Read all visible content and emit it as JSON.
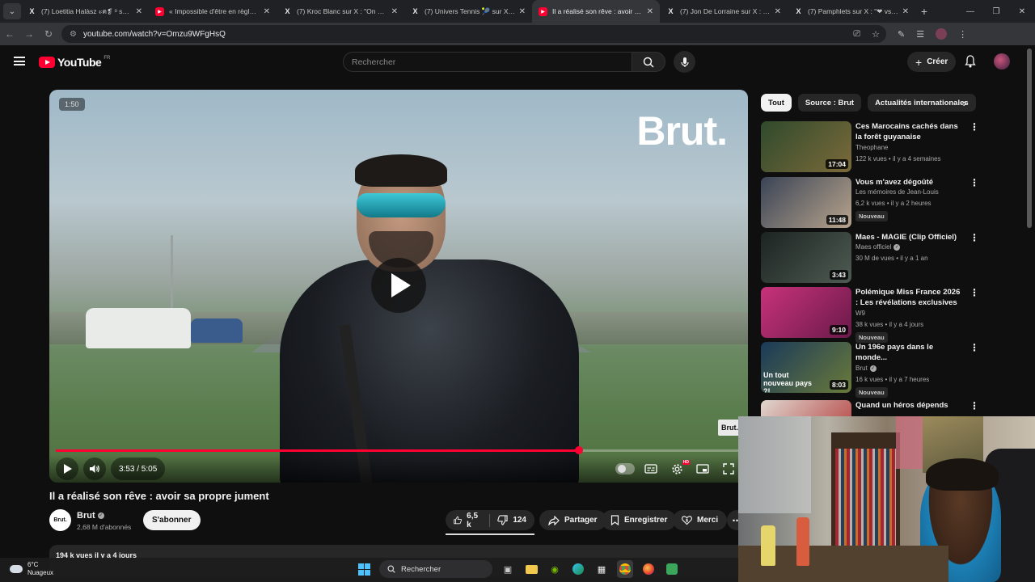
{
  "browser": {
    "tabs": [
      {
        "icon": "x-icon",
        "title": "(7) Loetitia Halàsz ะค❡ ᵒ sur X : ..."
      },
      {
        "icon": "youtube-icon",
        "title": "« Impossible d'être en règle ! » ..."
      },
      {
        "icon": "x-icon",
        "title": "(7) Kroc Blanc sur X : \"On est va..."
      },
      {
        "icon": "x-icon",
        "title": "(7) Univers Tennis 🎾 sur X : \"N..."
      },
      {
        "icon": "youtube-icon",
        "title": "Il a réalisé son rêve : avoir sa pr...",
        "active": true
      },
      {
        "icon": "x-icon",
        "title": "(7) Jon De Lorraine sur X : \"Cela..."
      },
      {
        "icon": "x-icon",
        "title": "(7) Pamphlets sur X : \"❤ vs BR..."
      }
    ],
    "url": "youtube.com/watch?v=Omzu9WFgHsQ"
  },
  "header": {
    "logo_text": "YouTube",
    "country_code": "FR",
    "search_placeholder": "Rechercher",
    "create_label": "Créer"
  },
  "player": {
    "speed_badge": "1:50",
    "watermark": "Brut.",
    "corner_watermark": "Brut.",
    "time": "3:53 / 5:05",
    "progress": 0.763
  },
  "video": {
    "title": "Il a réalisé son rêve : avoir sa propre jument",
    "channel": "Brut",
    "channel_avatar_text": "Brut.",
    "subscribers": "2,68 M d'abonnés",
    "subscribe_label": "S'abonner",
    "likes": "6,5 k",
    "dislikes": "124",
    "share_label": "Partager",
    "save_label": "Enregistrer",
    "thanks_label": "Merci",
    "description_meta": "194 k vues  il y a 4 jours"
  },
  "chips": [
    "Tout",
    "Source : Brut",
    "Actualités internationales"
  ],
  "recommendations": [
    {
      "title": "Ces Marocains cachés dans la forêt guyanaise",
      "channel": "Theophane",
      "verified": false,
      "meta": "122 k vues • il y a 4 semaines",
      "duration": "17:04",
      "badge": "",
      "thumb": [
        "#2f4a2c",
        "#7c6a3a"
      ]
    },
    {
      "title": "Vous m'avez dégoûté",
      "channel": "Les mémoires de Jean-Louis",
      "verified": false,
      "meta": "6,2 k vues • il y a 2 heures",
      "duration": "11:48",
      "badge": "Nouveau",
      "thumb": [
        "#3a4456",
        "#b8a48c"
      ]
    },
    {
      "title": "Maes - MAGIE (Clip Officiel)",
      "channel": "Maes officiel",
      "verified": true,
      "meta": "30 M de vues • il y a 1 an",
      "duration": "3:43",
      "badge": "",
      "thumb": [
        "#1c2422",
        "#4e5b52"
      ]
    },
    {
      "title": "Polémique Miss France 2026 : Les révélations exclusives ...",
      "channel": "W9",
      "verified": false,
      "meta": "38 k vues • il y a 4 jours",
      "duration": "9:10",
      "badge": "Nouveau",
      "thumb": [
        "#c8327a",
        "#6a1a4a"
      ]
    },
    {
      "title": "Un 196e pays dans le monde...",
      "channel": "Brut",
      "verified": true,
      "meta": "16 k vues • il y a 7 heures",
      "duration": "8:03",
      "badge": "Nouveau",
      "thumb": [
        "#1a3a5a",
        "#6a7a3a"
      ],
      "thumb_text": "Un tout nouveau pays ?!"
    },
    {
      "title": "Quand un héros dépends",
      "channel": "",
      "verified": false,
      "meta": "",
      "duration": "",
      "badge": "",
      "thumb": [
        "#e0d8d0",
        "#b03030"
      ]
    }
  ],
  "taskbar": {
    "temperature": "6°C",
    "condition": "Nuageux",
    "search_label": "Rechercher"
  }
}
